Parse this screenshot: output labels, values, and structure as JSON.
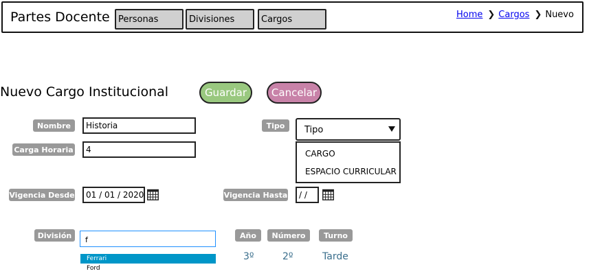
{
  "header": {
    "app_title": "Partes Docente",
    "tabs": [
      "Personas",
      "Divisiones",
      "Cargos"
    ],
    "breadcrumb": {
      "home": "Home",
      "cargos": "Cargos",
      "current": "Nuevo"
    }
  },
  "form": {
    "title": "Nuevo Cargo Institucional",
    "save_label": "Guardar",
    "cancel_label": "Cancelar",
    "colors": {
      "save": "#99c87f",
      "cancel": "#c882a8",
      "label_bg": "#999999"
    },
    "nombre": {
      "label": "Nombre",
      "value": "Historia"
    },
    "carga_horaria": {
      "label": "Carga Horaria",
      "value": "4"
    },
    "tipo": {
      "label": "Tipo",
      "selected": "Tipo",
      "options": [
        "CARGO",
        "ESPACIO CURRICULAR"
      ]
    },
    "vigencia_desde": {
      "label": "Vigencia Desde",
      "value": "01 / 01 / 2020"
    },
    "vigencia_hasta": {
      "label": "Vigencia Hasta",
      "value": "/  /"
    },
    "division": {
      "label": "División",
      "value": "f",
      "suggestions": [
        "Ferrari",
        "Ford"
      ]
    },
    "anio": {
      "label": "Año",
      "value": "3º"
    },
    "numero": {
      "label": "Número",
      "value": "2º"
    },
    "turno": {
      "label": "Turno",
      "value": "Tarde"
    }
  }
}
